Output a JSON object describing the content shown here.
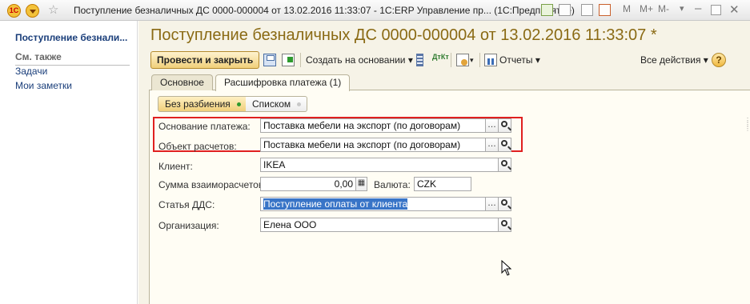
{
  "window": {
    "title": "Поступление безналичных ДС 0000-000004 от 13.02.2016 11:33:07 - 1С:ERP Управление пр...  (1С:Предприятие)",
    "logo_text": "1С",
    "right_controls": [
      "M",
      "M+",
      "M-"
    ]
  },
  "sidebar": {
    "header": "Поступление безнали...",
    "section": "См. также",
    "links": [
      "Задачи",
      "Мои заметки"
    ]
  },
  "form": {
    "title": "Поступление безналичных ДС 0000-000004 от 13.02.2016 11:33:07 *"
  },
  "toolbar": {
    "post_close": "Провести и закрыть",
    "create_based_on": "Создать на основании",
    "reports": "Отчеты",
    "all_actions": "Все действия",
    "help": "?",
    "dtkt_icon_text": "ДтКт"
  },
  "tabs": [
    {
      "label": "Основное",
      "active": false
    },
    {
      "label": "Расшифровка платежа (1)",
      "active": true
    }
  ],
  "mode_switch": {
    "options": [
      "Без разбиения",
      "Списком"
    ],
    "selected": "Без разбиения"
  },
  "fields": {
    "payment_basis": {
      "label": "Основание платежа:",
      "value": "Поставка мебели на экспорт (по договорам)"
    },
    "settlement_object": {
      "label": "Объект расчетов:",
      "value": "Поставка мебели на экспорт (по договорам)"
    },
    "client": {
      "label": "Клиент:",
      "value": "IKEA"
    },
    "amount": {
      "label": "Сумма взаиморасчетов:",
      "value": "0,00"
    },
    "currency": {
      "label": "Валюта:",
      "value": "CZK"
    },
    "cash_flow_item": {
      "label": "Статья ДДС:",
      "value": "Поступление оплаты от клиента"
    },
    "organization": {
      "label": "Организация:",
      "value": "Елена ООО"
    }
  },
  "colors": {
    "title_text": "#8a6a14",
    "form_bg": "#f6f3e7",
    "highlight_frame": "#e02020",
    "selection": "#3874c7"
  },
  "icons": [
    "save-icon",
    "post-icon",
    "list-icon",
    "dtkt-icon",
    "doc-icon",
    "report-icon",
    "search-icon",
    "calculator-icon"
  ]
}
